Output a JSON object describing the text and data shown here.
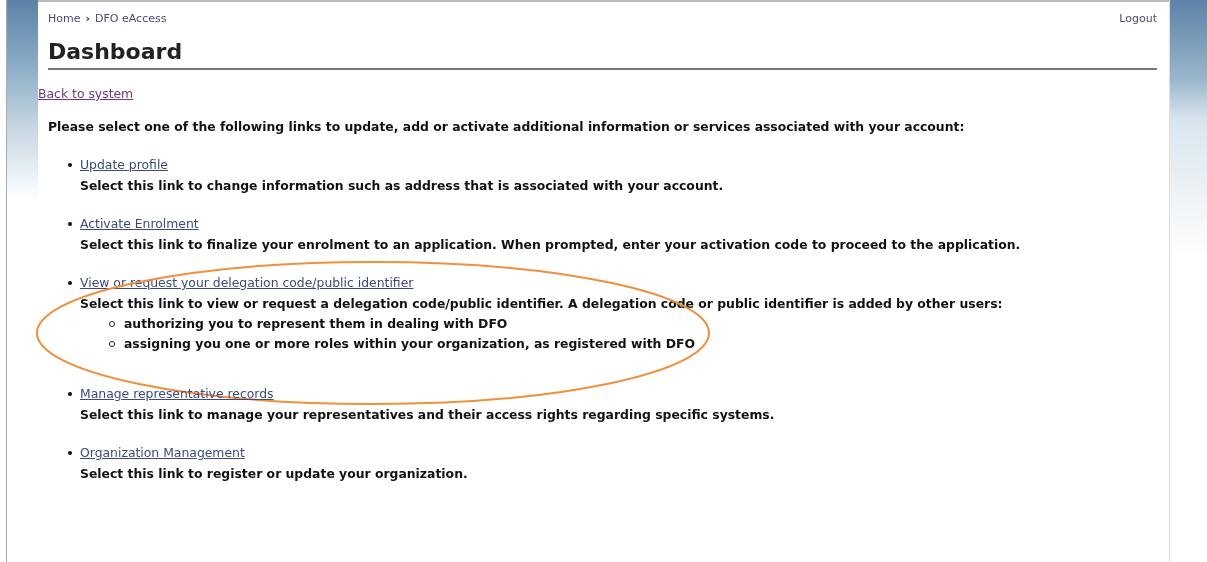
{
  "breadcrumb": [
    {
      "label": "Home"
    },
    {
      "label": "DFO eAccess"
    }
  ],
  "breadcrumb_separator": "›",
  "logout": "Logout",
  "title": "Dashboard",
  "back_link": "Back to system",
  "intro": "Please select one of the following links to update, add or activate additional information or services associated with your account:",
  "items": [
    {
      "link": "Update profile",
      "description": "Select this link to change information such as address that is associated with your account.",
      "highlighted": false
    },
    {
      "link": "Activate Enrolment",
      "description": "Select this link to finalize your enrolment to an application. When prompted, enter your activation code to proceed to the application.",
      "highlighted": false
    },
    {
      "link": "View or request your delegation code/public identifier",
      "description": "Select this link to view or request a delegation code/public identifier. A delegation code or public identifier is added by other users:",
      "sub_items": [
        "authorizing you to represent them in dealing with DFO",
        "assigning you one or more roles within your organization, as registered with DFO"
      ],
      "highlighted": true
    },
    {
      "link": "Manage representative records",
      "description": "Select this link to manage your representatives and their access rights regarding specific systems.",
      "highlighted": false
    },
    {
      "link": "Organization Management",
      "description": "Select this link to register or update your organization.",
      "highlighted": false
    }
  ]
}
